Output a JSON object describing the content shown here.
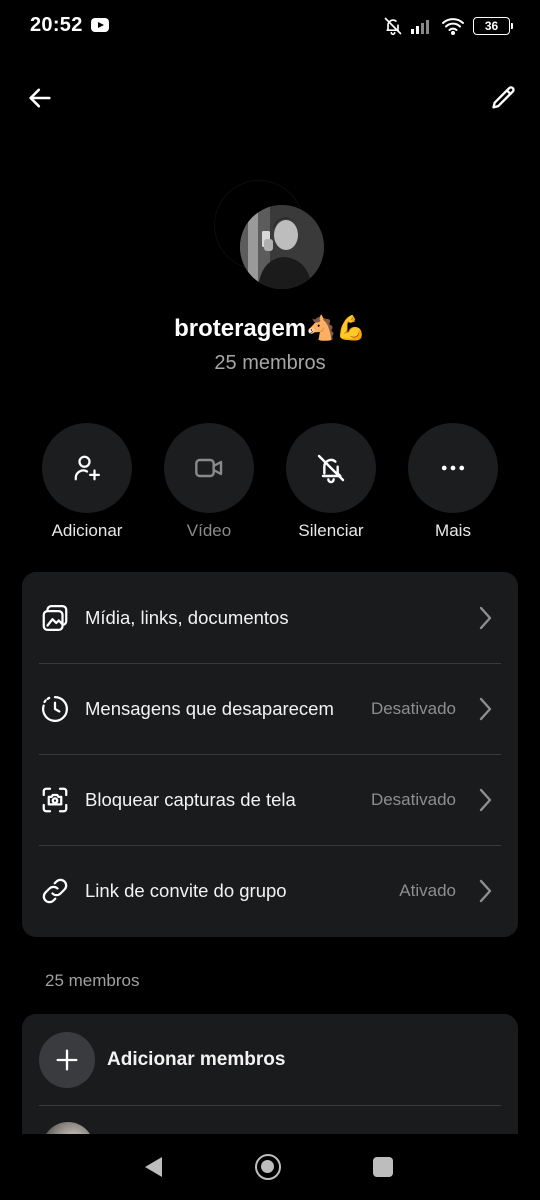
{
  "status_bar": {
    "time": "20:52",
    "battery": "36",
    "icons": [
      "youtube-icon",
      "bell-off-icon",
      "signal-icon",
      "wifi-icon",
      "battery-icon"
    ]
  },
  "header": {
    "back_icon": "arrow-left-icon",
    "edit_icon": "pencil-icon"
  },
  "group": {
    "name": "broteragem🐴💪",
    "members_count": "25 membros"
  },
  "actions": [
    {
      "label": "Adicionar",
      "icon": "add-user-icon",
      "enabled": true
    },
    {
      "label": "Vídeo",
      "icon": "video-icon",
      "enabled": false
    },
    {
      "label": "Silenciar",
      "icon": "bell-off-icon",
      "enabled": true
    },
    {
      "label": "Mais",
      "icon": "more-icon",
      "enabled": true
    }
  ],
  "settings": [
    {
      "label": "Mídia, links, documentos",
      "value": "",
      "icon": "media-icon"
    },
    {
      "label": "Mensagens que desaparecem",
      "value": "Desativado",
      "icon": "timer-icon"
    },
    {
      "label": "Bloquear capturas de tela",
      "value": "Desativado",
      "icon": "screenshot-icon"
    },
    {
      "label": "Link de convite do grupo",
      "value": "Ativado",
      "icon": "link-icon"
    }
  ],
  "members_section": {
    "title": "25 membros",
    "add_label": "Adicionar membros"
  },
  "colors": {
    "background": "#000000",
    "card": "#1a1b1d",
    "circle": "#1c1d1f",
    "muted_text": "#8e8e8e"
  }
}
